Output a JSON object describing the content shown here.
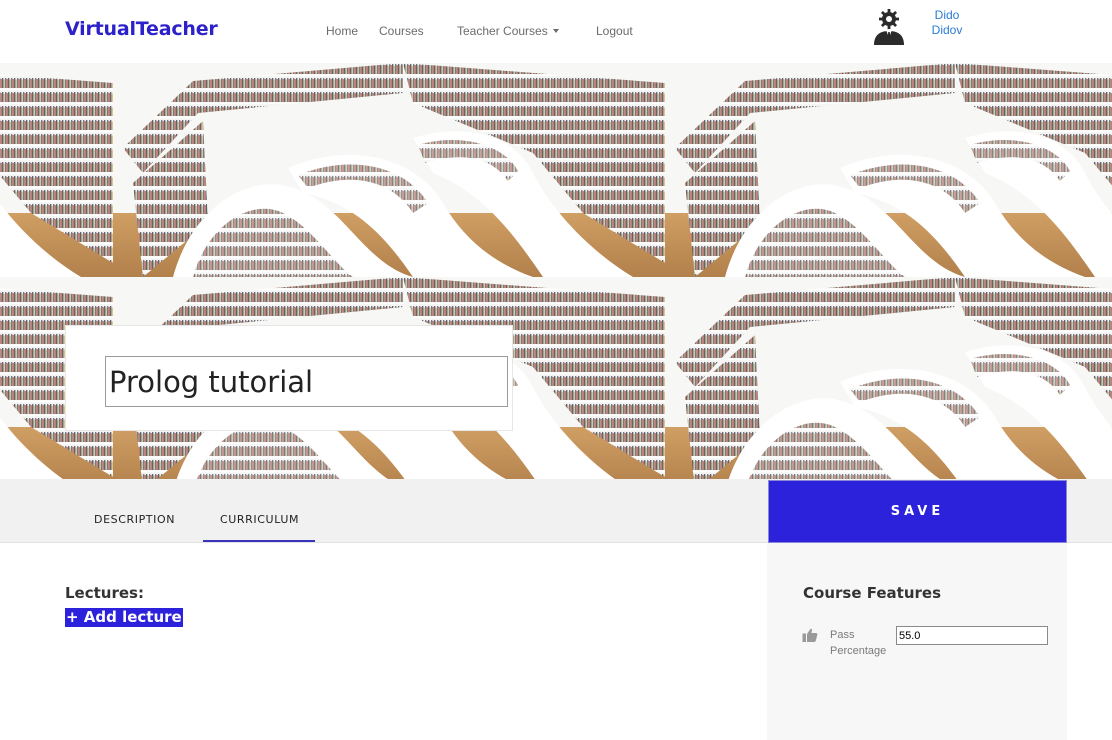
{
  "header": {
    "brand": "VirtualTeacher",
    "nav": {
      "home": "Home",
      "courses": "Courses",
      "teacher_courses": "Teacher Courses",
      "logout": "Logout"
    },
    "user": {
      "first_name": "Dido",
      "last_name": "Didov",
      "avatar_icon": "user-avatar-gear-icon"
    }
  },
  "hero": {
    "background": "library-bookshelves-image"
  },
  "course": {
    "title": "Prolog tutorial"
  },
  "tabs": [
    {
      "label": "DESCRIPTION"
    },
    {
      "label": "CURRICULUM"
    }
  ],
  "active_tab": "CURRICULUM",
  "save": {
    "label": "SAVE"
  },
  "curriculum": {
    "lectures_label": "Lectures:",
    "add_lecture_label": "+ Add lecture"
  },
  "features": {
    "title": "Course Features",
    "pass_icon": "thumbs-up-icon",
    "pass_label_line1": "Pass",
    "pass_label_line2": "Percentage",
    "pass_value": "55.0"
  },
  "colors": {
    "brand": "#2d22c9",
    "accent_button": "#2d22dc",
    "user_link": "#2a7cd6",
    "tab_underline": "#3a35b8"
  }
}
